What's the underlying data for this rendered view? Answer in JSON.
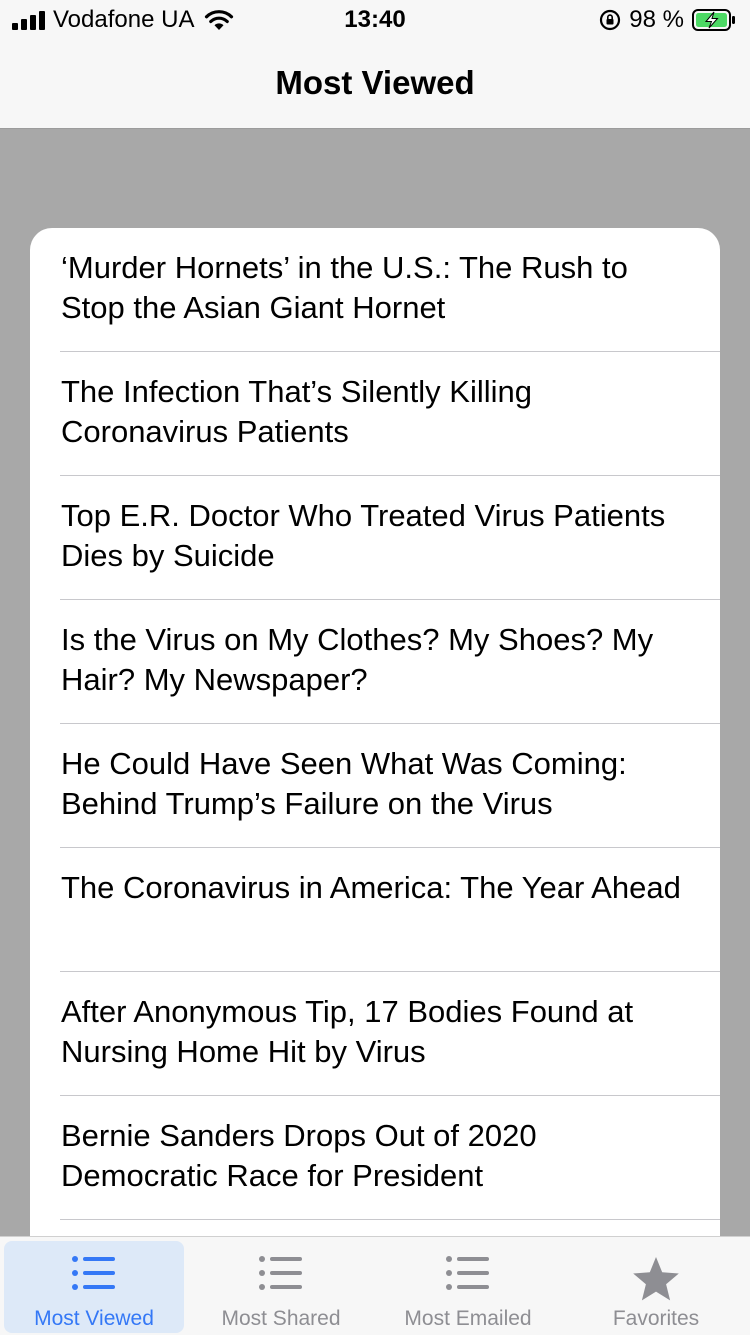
{
  "status": {
    "carrier": "Vodafone UA",
    "time": "13:40",
    "battery": "98 %"
  },
  "nav": {
    "title": "Most Viewed"
  },
  "articles": [
    {
      "title": "‘Murder Hornets’ in the U.S.: The Rush to Stop the Asian Giant Hornet"
    },
    {
      "title": "The Infection That’s Silently Killing Coronavirus Patients"
    },
    {
      "title": "Top E.R. Doctor Who Treated Virus Patients Dies by Suicide"
    },
    {
      "title": "Is the Virus on My Clothes? My Shoes? My Hair? My Newspaper?"
    },
    {
      "title": "He Could Have Seen What Was Coming: Behind Trump’s Failure on the Virus"
    },
    {
      "title": "The Coronavirus in America: The Year Ahead"
    },
    {
      "title": "After Anonymous Tip, 17 Bodies Found at Nursing Home Hit by Virus"
    },
    {
      "title": "Bernie Sanders Drops Out of 2020 Democratic Race for President"
    }
  ],
  "tabs": [
    {
      "label": "Most Viewed",
      "icon": "list-icon",
      "active": true
    },
    {
      "label": "Most Shared",
      "icon": "list-icon",
      "active": false
    },
    {
      "label": "Most Emailed",
      "icon": "list-icon",
      "active": false
    },
    {
      "label": "Favorites",
      "icon": "star-icon",
      "active": false
    }
  ],
  "colors": {
    "accent": "#3478f6",
    "inactive": "#8e8e93",
    "background": "#a8a8a8",
    "battery_charging": "#4cd964"
  }
}
